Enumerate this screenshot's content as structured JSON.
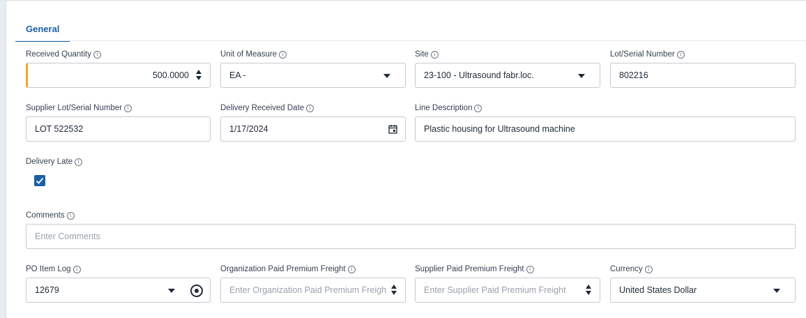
{
  "tabs": [
    {
      "label": "General"
    }
  ],
  "info_glyph": "i",
  "fields": {
    "received_quantity": {
      "label": "Received Quantity",
      "value": "500.0000"
    },
    "unit_of_measure": {
      "label": "Unit of Measure",
      "value": "EA -"
    },
    "site": {
      "label": "Site",
      "value": "23-100 - Ultrasound fabr.loc."
    },
    "lot_serial_number": {
      "label": "Lot/Serial Number",
      "value": "802216"
    },
    "supplier_lot_serial_number": {
      "label": "Supplier Lot/Serial Number",
      "value": "LOT 522532"
    },
    "delivery_received_date": {
      "label": "Delivery Received Date",
      "value": "1/17/2024"
    },
    "line_description": {
      "label": "Line Description",
      "value": "Plastic housing for Ultrasound machine"
    },
    "delivery_late": {
      "label": "Delivery Late",
      "checked": true
    },
    "comments": {
      "label": "Comments",
      "placeholder": "Enter Comments"
    },
    "po_item_log": {
      "label": "PO Item Log",
      "value": "12679"
    },
    "org_paid_premium_freight": {
      "label": "Organization Paid Premium Freight",
      "placeholder": "Enter Organization Paid Premium Freigh"
    },
    "supplier_paid_premium_freight": {
      "label": "Supplier Paid Premium Freight",
      "placeholder": "Enter Supplier Paid Premium Freight"
    },
    "currency": {
      "label": "Currency",
      "value": "United States Dollar"
    }
  },
  "colors": {
    "accent": "#1a5fa8",
    "active_marker": "#f5a623"
  }
}
